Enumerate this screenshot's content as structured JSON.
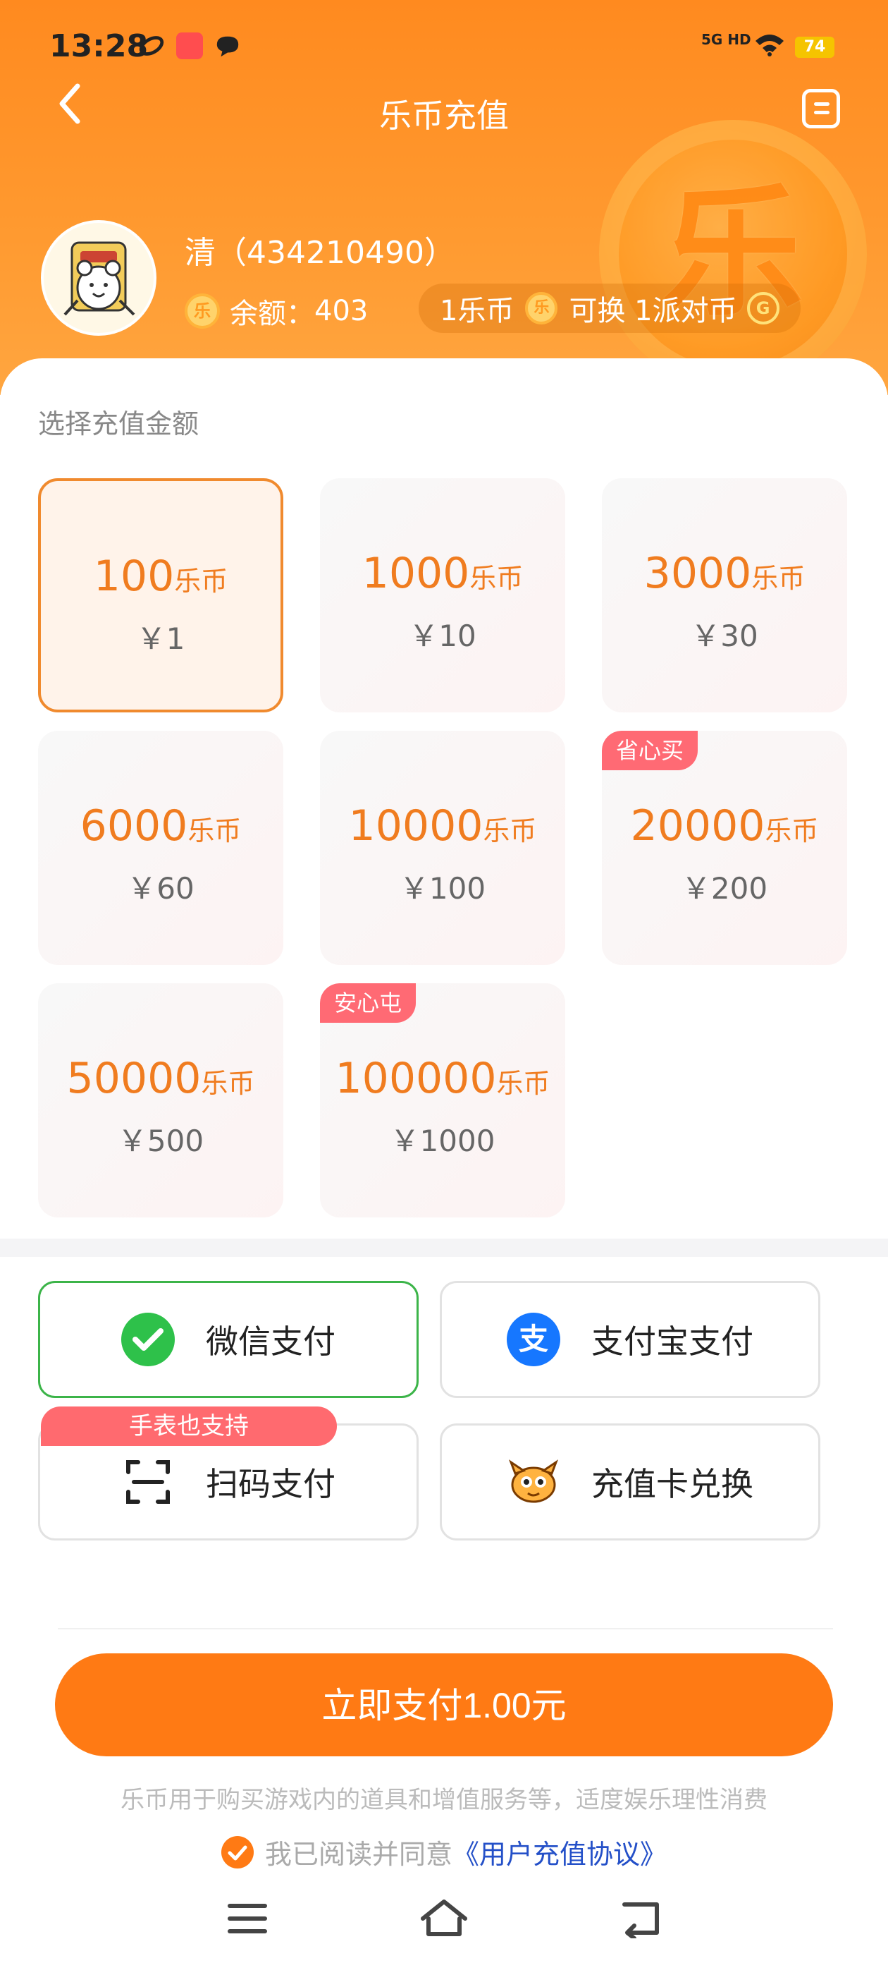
{
  "status_bar": {
    "time": "13:28",
    "network": "5G HD",
    "battery": "74"
  },
  "nav": {
    "title": "乐币充值"
  },
  "user": {
    "name": "清（434210490）",
    "balance_label": "余额：",
    "balance": "403",
    "coin_glyph": "乐"
  },
  "exchange": {
    "left": "1乐币",
    "right": "可换 1派对币",
    "party_glyph": "G"
  },
  "section_label": "选择充值金额",
  "packages": [
    {
      "amount": "100",
      "unit": "乐币",
      "price": "￥1",
      "tag": "",
      "selected": true
    },
    {
      "amount": "1000",
      "unit": "乐币",
      "price": "￥10",
      "tag": ""
    },
    {
      "amount": "3000",
      "unit": "乐币",
      "price": "￥30",
      "tag": ""
    },
    {
      "amount": "6000",
      "unit": "乐币",
      "price": "￥60",
      "tag": ""
    },
    {
      "amount": "10000",
      "unit": "乐币",
      "price": "￥100",
      "tag": ""
    },
    {
      "amount": "20000",
      "unit": "乐币",
      "price": "￥200",
      "tag": "省心买"
    },
    {
      "amount": "50000",
      "unit": "乐币",
      "price": "￥500",
      "tag": ""
    },
    {
      "amount": "100000",
      "unit": "乐币",
      "price": "￥1000",
      "tag": "安心屯"
    }
  ],
  "payment_methods": {
    "wechat": "微信支付",
    "alipay": "支付宝支付",
    "scan": "扫码支付",
    "card": "充值卡兑换",
    "watch_tag": "手表也支持",
    "alipay_glyph": "支"
  },
  "pay_button": "立即支付1.00元",
  "notice": "乐币用于购买游戏内的道具和增值服务等，适度娱乐理性消费",
  "agreement": {
    "prefix": "我已阅读并同意",
    "link": "《用户充值协议》"
  },
  "colors": {
    "brand_orange": "#ff7a14",
    "selected_green": "#3cb449",
    "tag_red": "#ff6a74"
  }
}
